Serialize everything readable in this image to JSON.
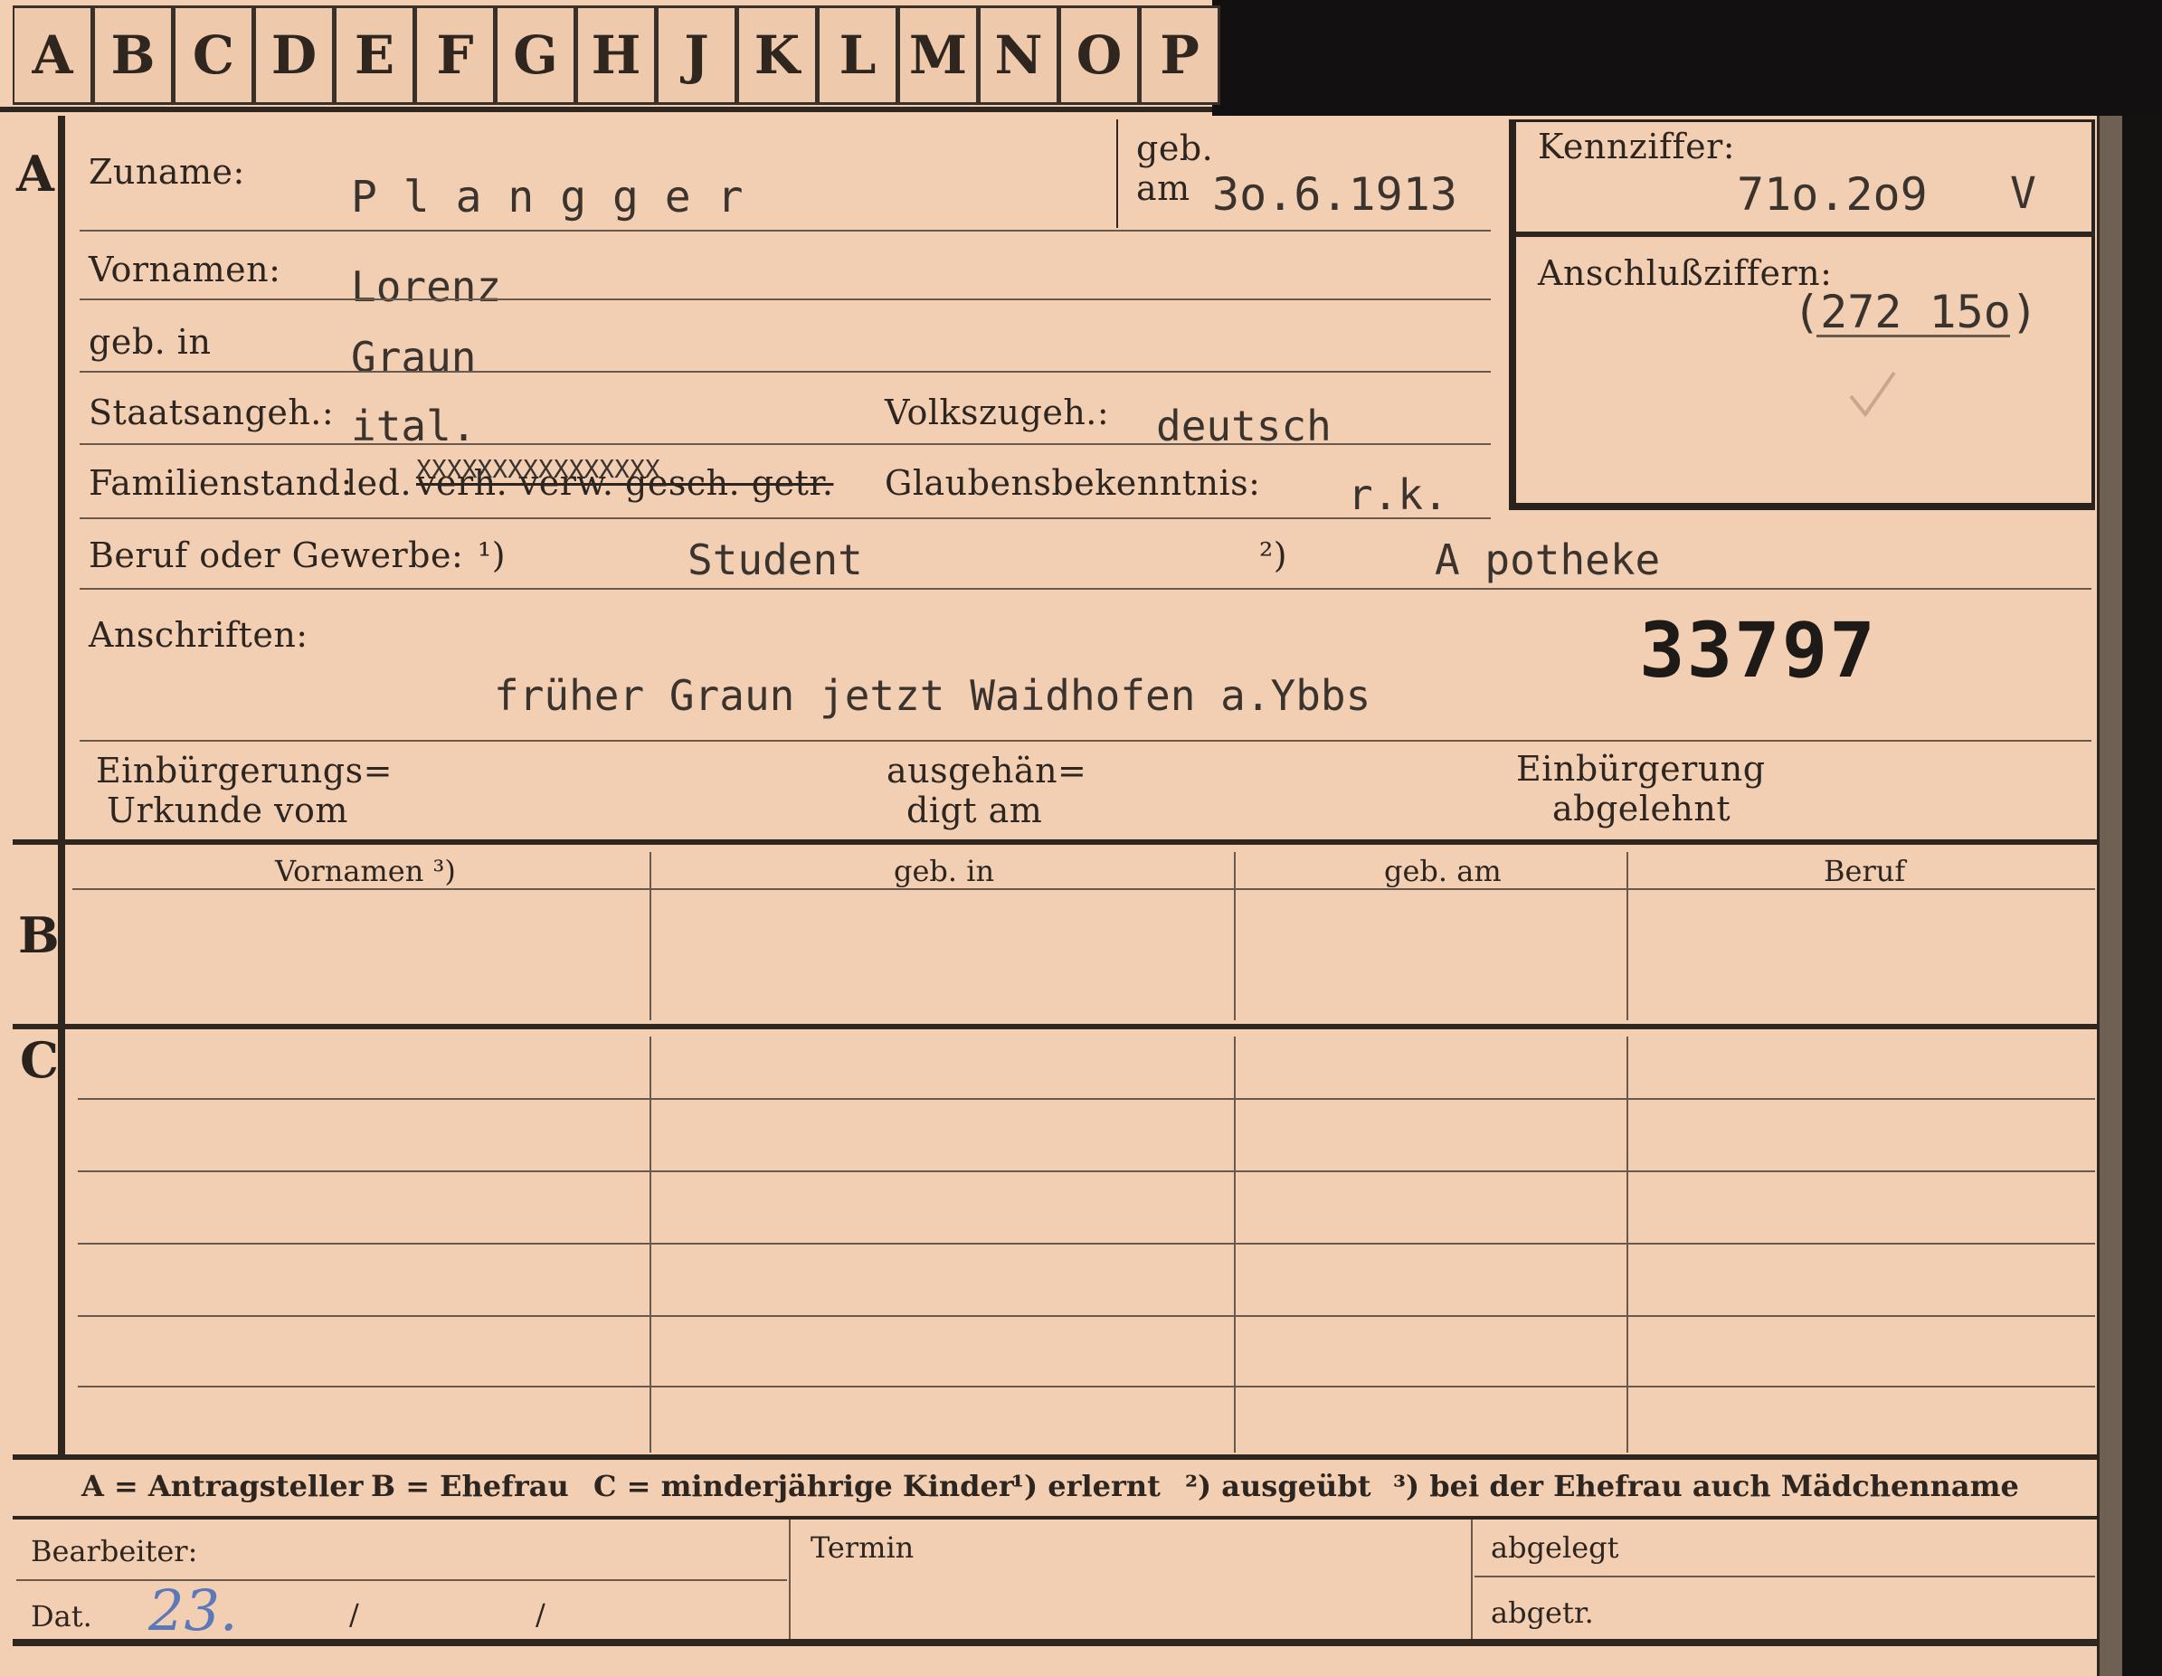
{
  "tab_letters": [
    "A",
    "B",
    "C",
    "D",
    "E",
    "F",
    "G",
    "H",
    "J",
    "K",
    "L",
    "M",
    "N",
    "O",
    "P"
  ],
  "section_a": {
    "marker": "A",
    "zuname_label": "Zuname:",
    "zuname_value": "P l a n g g e r",
    "geb_label": "geb.",
    "am_label": "am",
    "geb_am_value": "3o.6.1913",
    "kennziffer_label": "Kennziffer:",
    "kennziffer_value": "71o.2o9",
    "kennziffer_suffix": "V",
    "anschluss_label": "Anschlußziffern:",
    "anschluss_value": "(272 15o)",
    "vornamen_label": "Vornamen:",
    "vornamen_value": "Lorenz",
    "geb_in_label": "geb. in",
    "geb_in_value": "Graun",
    "staatsangeh_label": "Staatsangeh.:",
    "staatsangeh_value": "ital.",
    "volkszugeh_label": "Volkszugeh.:",
    "volkszugeh_value": "deutsch",
    "familienstand_label": "Familienstand:",
    "familienstand_led": "led.",
    "familienstand_struck": "verh. verw. gesch. getr.",
    "familienstand_overtype": "XXXXXXXXXXXXXXXX",
    "glauben_label": "Glaubensbekenntnis:",
    "glauben_value": "r.k.",
    "beruf_label": "Beruf oder Gewerbe:",
    "beruf_mark1": "¹)",
    "beruf_value1": "Student",
    "beruf_mark2": "²)",
    "beruf_value2": "A potheke",
    "anschriften_label": "Anschriften:",
    "anschriften_value": "früher Graun jetzt Waidhofen a.Ybbs",
    "stamp_number": "33797",
    "einb_urkunde_label": "Einbürgerungs=",
    "einb_urkunde_label2": "Urkunde vom",
    "ausgehaen_label": "ausgehän=",
    "ausgehaen_label2": "digt am",
    "einb_abgelehnt_label": "Einbürgerung",
    "einb_abgelehnt_label2": "abgelehnt"
  },
  "section_b": {
    "marker": "B",
    "columns": [
      "Vornamen ³)",
      "geb. in",
      "geb. am",
      "Beruf"
    ]
  },
  "section_c": {
    "marker": "C"
  },
  "legend": {
    "a": "A = Antragsteller",
    "b": "B = Ehefrau",
    "c": "C = minderjährige Kinder",
    "n1": "¹) erlernt",
    "n2": "²) ausgeübt",
    "n3": "³) bei der Ehefrau auch Mädchenname"
  },
  "footer": {
    "bearbeiter_label": "Bearbeiter:",
    "dat_label": "Dat.",
    "dat_hand": "23.",
    "dat_slash1": "/",
    "dat_slash2": "/",
    "termin_label": "Termin",
    "abgelegt_label": "abgelegt",
    "abgetr_label": "abgetr."
  }
}
